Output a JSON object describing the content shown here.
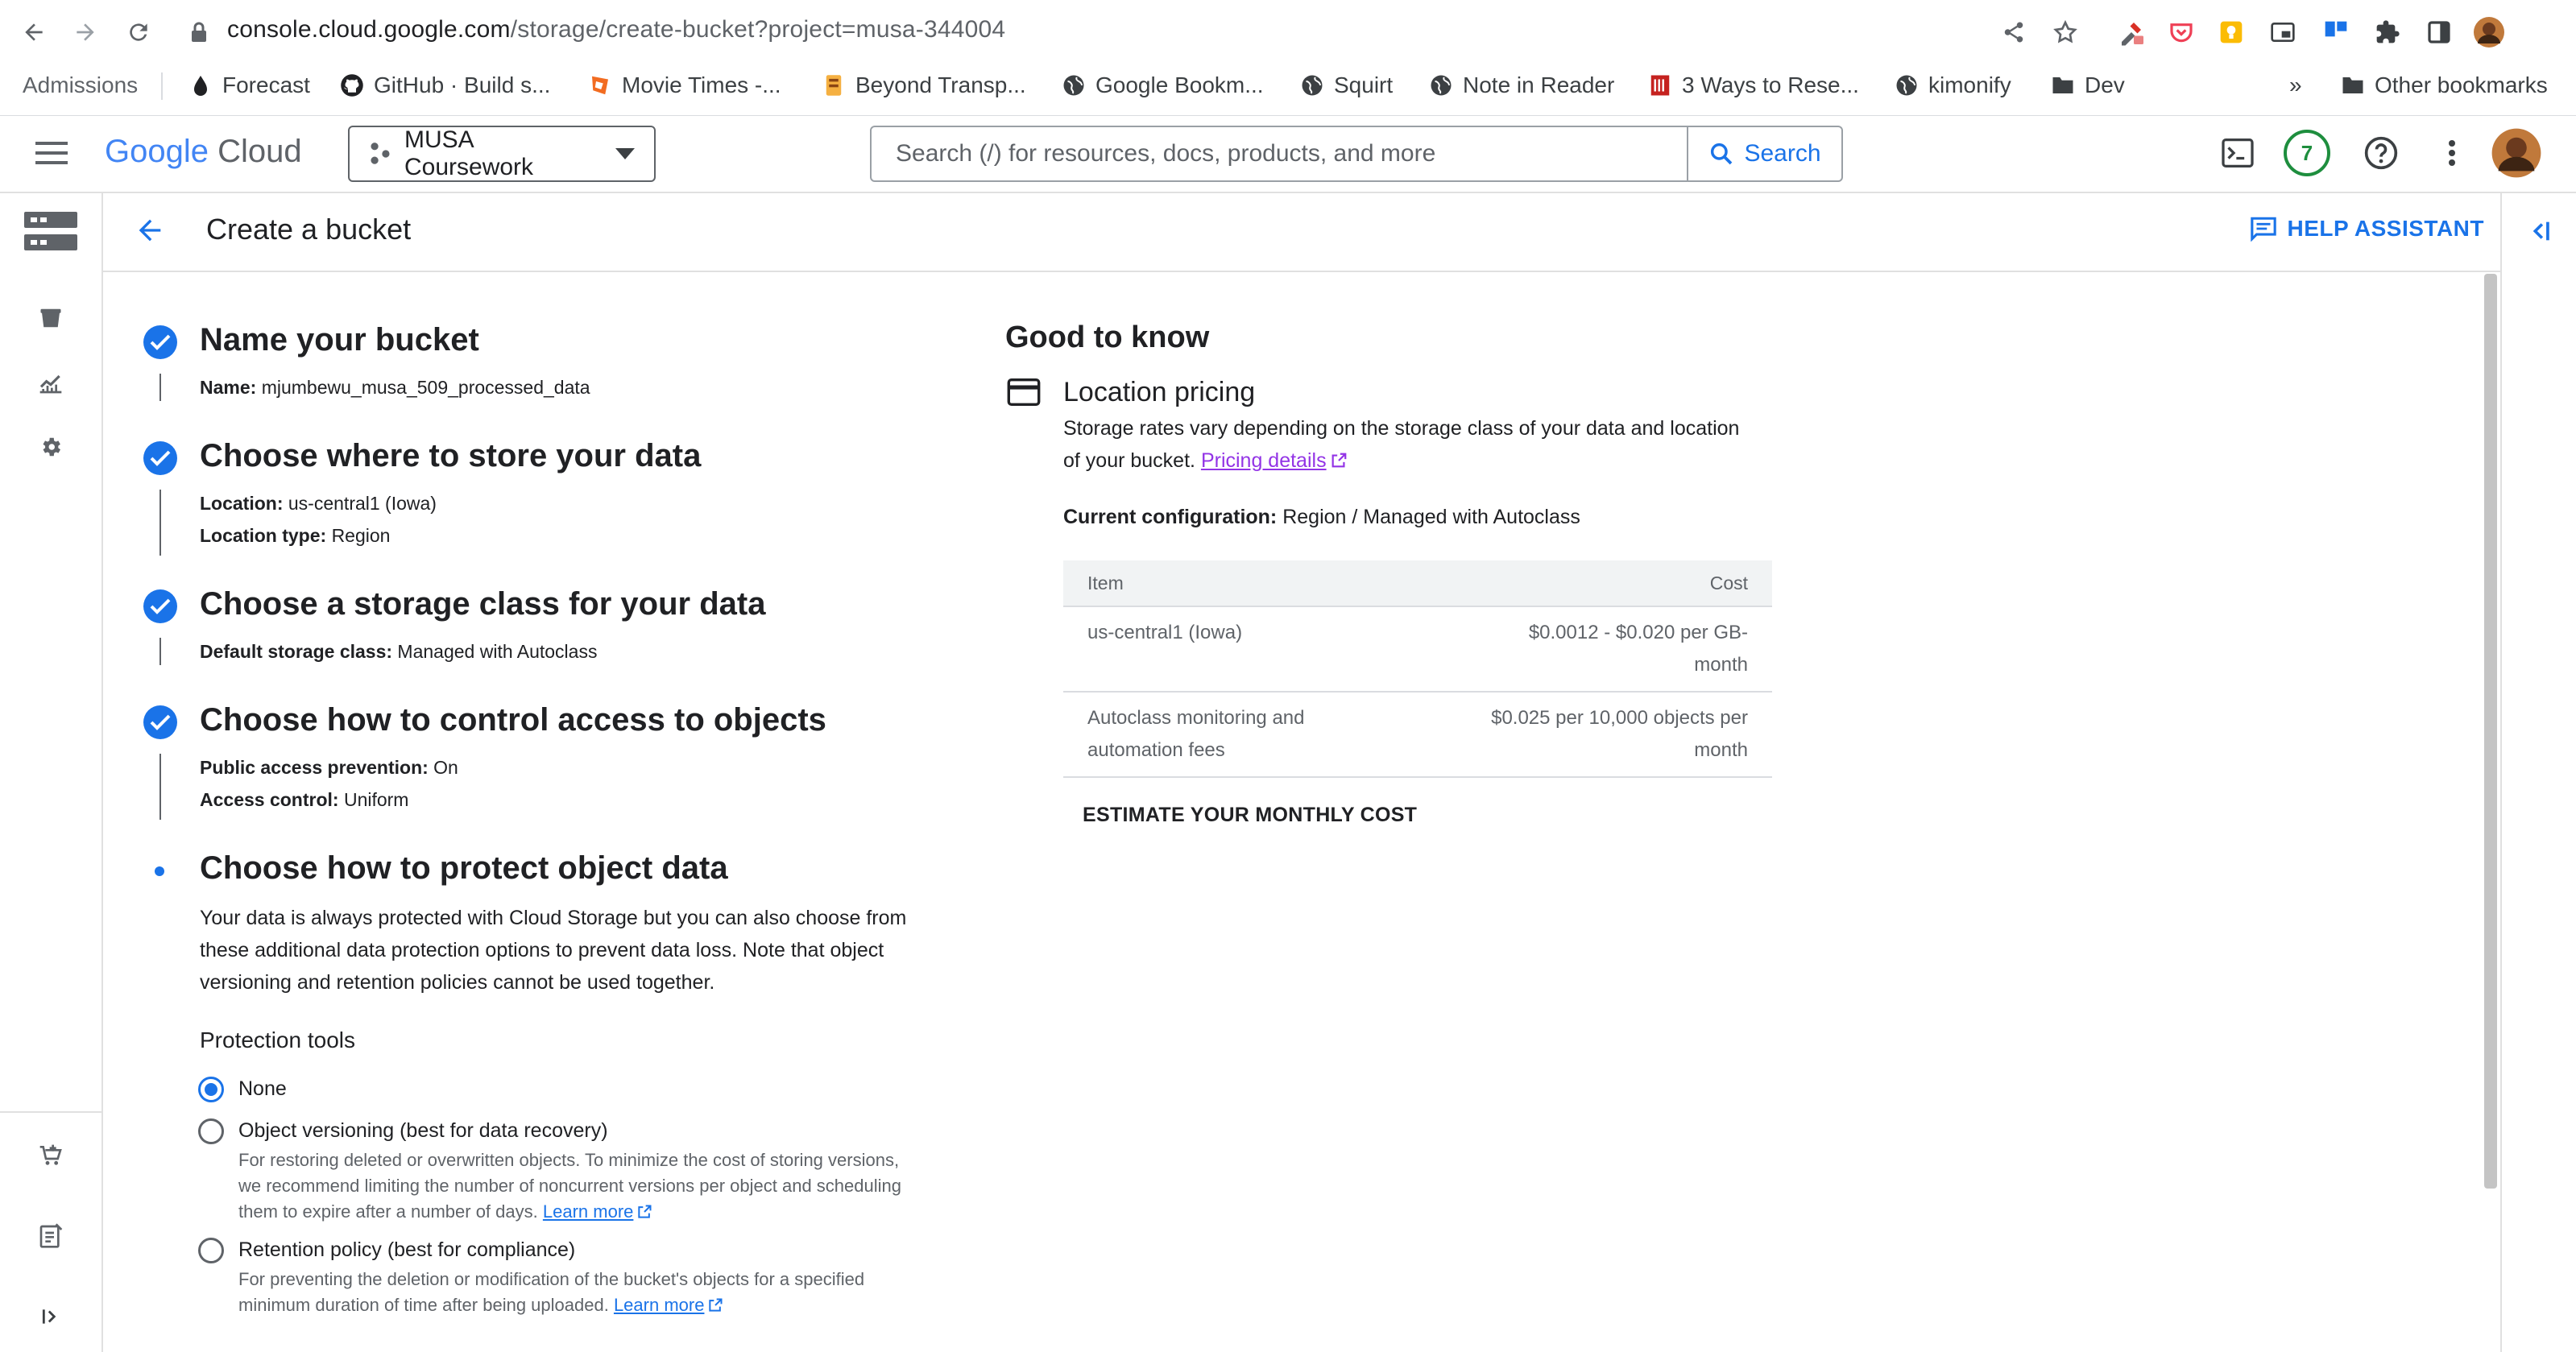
{
  "browser": {
    "url_host": "console.cloud.google.com",
    "url_path": "/storage/create-bucket?project=musa-344004",
    "bookmarks": [
      {
        "label": "Admissions",
        "icon": "none"
      },
      {
        "label": "Forecast",
        "icon": "forecast-icon"
      },
      {
        "label": "GitHub · Build s...",
        "icon": "github-icon"
      },
      {
        "label": "Movie Times -...",
        "icon": "movie-icon"
      },
      {
        "label": "Beyond Transp...",
        "icon": "beyond-icon"
      },
      {
        "label": "Google Bookm...",
        "icon": "globe-icon"
      },
      {
        "label": "Squirt",
        "icon": "globe-icon"
      },
      {
        "label": "Note in Reader",
        "icon": "globe-icon"
      },
      {
        "label": "3 Ways to Rese...",
        "icon": "article-icon"
      },
      {
        "label": "kimonify",
        "icon": "globe-icon"
      },
      {
        "label": "Dev",
        "icon": "folder-icon"
      }
    ],
    "overflow_label": "»",
    "other_bookmarks": "Other bookmarks"
  },
  "header": {
    "logo_google": "Google",
    "logo_cloud": "Cloud",
    "project": "MUSA Coursework",
    "search_placeholder": "Search (/) for resources, docs, products, and more",
    "search_button": "Search",
    "notifications_count": "7"
  },
  "page": {
    "title": "Create a bucket",
    "help_assistant": "HELP ASSISTANT"
  },
  "steps": [
    {
      "title": "Name your bucket",
      "details": [
        {
          "label": "Name:",
          "value": "mjumbewu_musa_509_processed_data"
        }
      ]
    },
    {
      "title": "Choose where to store your data",
      "details": [
        {
          "label": "Location:",
          "value": "us-central1 (Iowa)"
        },
        {
          "label": "Location type:",
          "value": "Region"
        }
      ]
    },
    {
      "title": "Choose a storage class for your data",
      "details": [
        {
          "label": "Default storage class:",
          "value": "Managed with Autoclass"
        }
      ]
    },
    {
      "title": "Choose how to control access to objects",
      "details": [
        {
          "label": "Public access prevention:",
          "value": "On"
        },
        {
          "label": "Access control:",
          "value": "Uniform"
        }
      ]
    },
    {
      "title": "Choose how to protect object data"
    }
  ],
  "protect": {
    "paragraph_lines": [
      "Your data is always protected with Cloud Storage but you can also choose from",
      "these additional data protection options to prevent data loss. Note that object",
      "versioning and retention policies cannot be used together."
    ],
    "tools_heading": "Protection tools",
    "options": [
      {
        "label": "None",
        "selected": true,
        "help_lines": []
      },
      {
        "label": "Object versioning (best for data recovery)",
        "selected": false,
        "help_lines": [
          "For restoring deleted or overwritten objects. To minimize the cost of storing versions,",
          "we recommend limiting the number of noncurrent versions per object and scheduling",
          "them to expire after a number of days."
        ],
        "link": "Learn more"
      },
      {
        "label": "Retention policy (best for compliance)",
        "selected": false,
        "help_lines": [
          "For preventing the deletion or modification of the bucket's objects for a specified",
          "minimum duration of time after being uploaded."
        ],
        "link": "Learn more"
      }
    ]
  },
  "good_to_know": {
    "title": "Good to know",
    "section_title": "Location pricing",
    "text_line1": "Storage rates vary depending on the storage class of your data and location",
    "text_line2": "of your bucket.",
    "pricing_link": "Pricing details",
    "current_config_label": "Current configuration:",
    "current_config_value": "Region / Managed with Autoclass",
    "table": {
      "headers": [
        "Item",
        "Cost"
      ],
      "rows": [
        {
          "item_lines": [
            "us-central1 (Iowa)"
          ],
          "cost_lines": [
            "$0.0012 - $0.020 per GB-",
            "month"
          ]
        },
        {
          "item_lines": [
            "Autoclass monitoring and",
            "automation fees"
          ],
          "cost_lines": [
            "$0.025 per 10,000 objects per",
            "month"
          ]
        }
      ]
    },
    "estimate_button": "ESTIMATE YOUR MONTHLY COST"
  },
  "colors": {
    "accent": "#1a73e8",
    "link_visited": "#9334e6",
    "badge_green": "#1e8e3e"
  }
}
